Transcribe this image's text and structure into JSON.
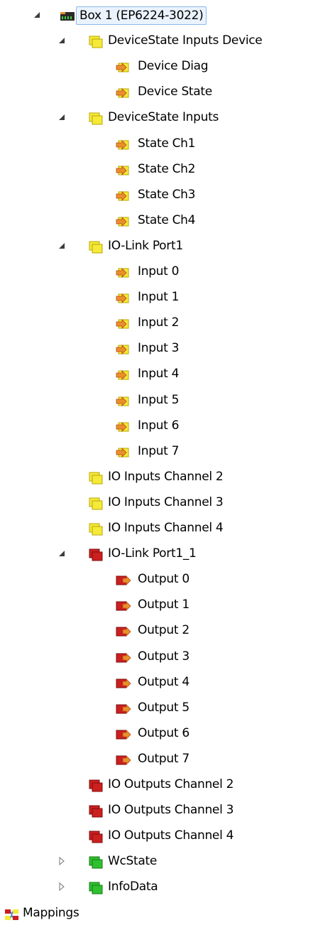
{
  "tree": {
    "nodes": [
      {
        "label": "Box 1 (EP6224-3022)",
        "level": 0,
        "icon": "box-icon",
        "expander": "expanded",
        "selected": true
      },
      {
        "label": "DeviceState Inputs Device",
        "level": 1,
        "icon": "input-group-icon",
        "expander": "expanded"
      },
      {
        "label": "Device Diag",
        "level": 2,
        "icon": "input-variable-icon",
        "expander": "none"
      },
      {
        "label": "Device State",
        "level": 2,
        "icon": "input-variable-icon",
        "expander": "none"
      },
      {
        "label": "DeviceState Inputs",
        "level": 1,
        "icon": "input-group-icon",
        "expander": "expanded"
      },
      {
        "label": "State Ch1",
        "level": 2,
        "icon": "input-variable-icon",
        "expander": "none"
      },
      {
        "label": "State Ch2",
        "level": 2,
        "icon": "input-variable-icon",
        "expander": "none"
      },
      {
        "label": "State Ch3",
        "level": 2,
        "icon": "input-variable-icon",
        "expander": "none"
      },
      {
        "label": "State Ch4",
        "level": 2,
        "icon": "input-variable-icon",
        "expander": "none"
      },
      {
        "label": "IO-Link Port1",
        "level": 1,
        "icon": "input-group-icon",
        "expander": "expanded"
      },
      {
        "label": "Input 0",
        "level": 2,
        "icon": "input-variable-icon",
        "expander": "none"
      },
      {
        "label": "Input 1",
        "level": 2,
        "icon": "input-variable-icon",
        "expander": "none"
      },
      {
        "label": "Input 2",
        "level": 2,
        "icon": "input-variable-icon",
        "expander": "none"
      },
      {
        "label": "Input 3",
        "level": 2,
        "icon": "input-variable-icon",
        "expander": "none"
      },
      {
        "label": "Input 4",
        "level": 2,
        "icon": "input-variable-icon",
        "expander": "none"
      },
      {
        "label": "Input 5",
        "level": 2,
        "icon": "input-variable-icon",
        "expander": "none"
      },
      {
        "label": "Input 6",
        "level": 2,
        "icon": "input-variable-icon",
        "expander": "none"
      },
      {
        "label": "Input 7",
        "level": 2,
        "icon": "input-variable-icon",
        "expander": "none"
      },
      {
        "label": "IO Inputs Channel 2",
        "level": 1,
        "icon": "input-group-icon",
        "expander": "none"
      },
      {
        "label": "IO Inputs Channel 3",
        "level": 1,
        "icon": "input-group-icon",
        "expander": "none"
      },
      {
        "label": "IO Inputs Channel 4",
        "level": 1,
        "icon": "input-group-icon",
        "expander": "none"
      },
      {
        "label": "IO-Link Port1_1",
        "level": 1,
        "icon": "output-group-icon",
        "expander": "expanded"
      },
      {
        "label": "Output 0",
        "level": 2,
        "icon": "output-variable-icon",
        "expander": "none"
      },
      {
        "label": "Output 1",
        "level": 2,
        "icon": "output-variable-icon",
        "expander": "none"
      },
      {
        "label": "Output 2",
        "level": 2,
        "icon": "output-variable-icon",
        "expander": "none"
      },
      {
        "label": "Output 3",
        "level": 2,
        "icon": "output-variable-icon",
        "expander": "none"
      },
      {
        "label": "Output 4",
        "level": 2,
        "icon": "output-variable-icon",
        "expander": "none"
      },
      {
        "label": "Output 5",
        "level": 2,
        "icon": "output-variable-icon",
        "expander": "none"
      },
      {
        "label": "Output 6",
        "level": 2,
        "icon": "output-variable-icon",
        "expander": "none"
      },
      {
        "label": "Output 7",
        "level": 2,
        "icon": "output-variable-icon",
        "expander": "none"
      },
      {
        "label": "IO Outputs Channel 2",
        "level": 1,
        "icon": "output-group-icon",
        "expander": "none"
      },
      {
        "label": "IO Outputs Channel 3",
        "level": 1,
        "icon": "output-group-icon",
        "expander": "none"
      },
      {
        "label": "IO Outputs Channel 4",
        "level": 1,
        "icon": "output-group-icon",
        "expander": "none"
      },
      {
        "label": "WcState",
        "level": 1,
        "icon": "status-group-icon",
        "expander": "collapsed"
      },
      {
        "label": "InfoData",
        "level": 1,
        "icon": "status-group-icon",
        "expander": "collapsed"
      },
      {
        "label": "Mappings",
        "level": -1,
        "icon": "mappings-icon",
        "expander": "none"
      }
    ]
  },
  "colors": {
    "selection_background": "#eaf3fd",
    "selection_border": "#8ab9e9",
    "input_group": "#f5e93a",
    "output_group": "#cc1f1f",
    "status_group": "#2fbf2f",
    "variable_arrow": "#e8902a"
  }
}
